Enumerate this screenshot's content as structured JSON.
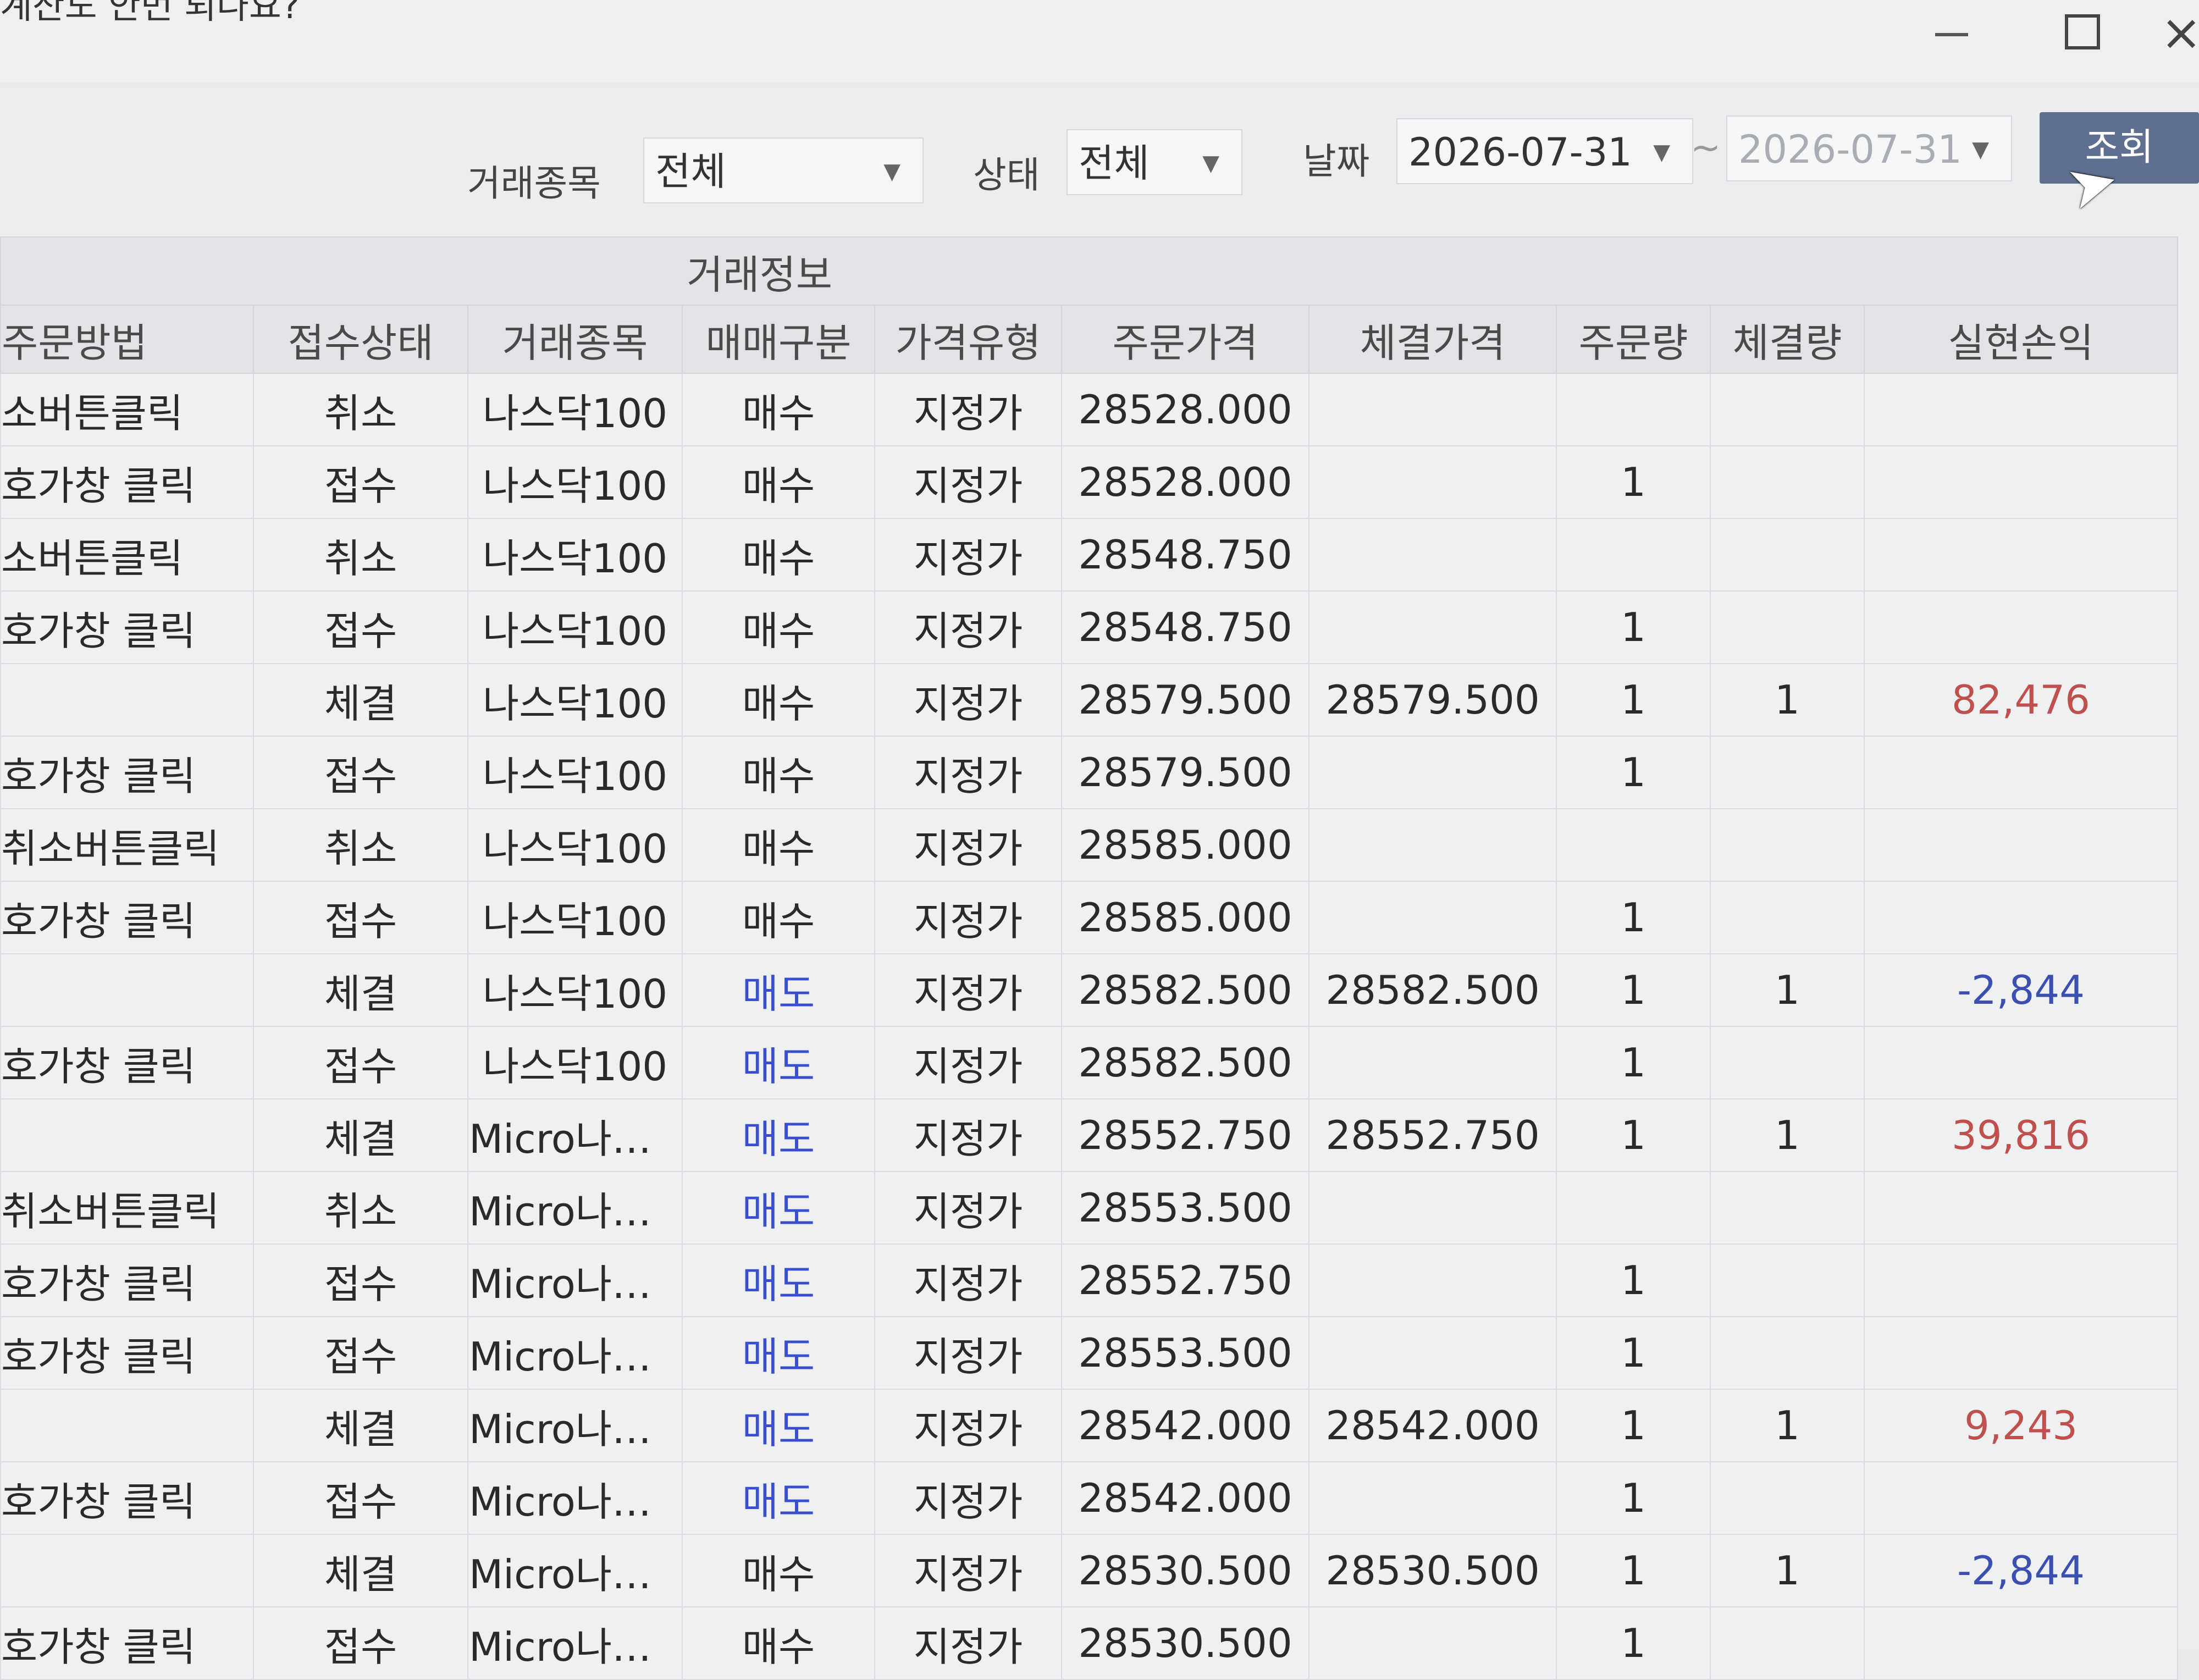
{
  "window": {
    "title": "계산도 안먼 되나요?",
    "close_symbol": "×"
  },
  "filters": {
    "item_label": "거래종목",
    "item_value": "전체",
    "status_label": "상태",
    "status_value": "전체",
    "date_label": "날짜",
    "date_from": "2026-07-31",
    "date_sep": "~",
    "date_to": "2026-07-31",
    "query_label": "조회"
  },
  "grid": {
    "group_header": "거래정보",
    "columns": [
      "주문방법",
      "접수상태",
      "거래종목",
      "매매구분",
      "가격유형",
      "주문가격",
      "체결가격",
      "주문량",
      "체결량",
      "실현손익"
    ],
    "rows": [
      {
        "method": "소버튼클릭",
        "status": "취소",
        "item": "나스닥100",
        "side": "매수",
        "ptype": "지정가",
        "oprice": "28528.000",
        "fprice": "",
        "oqty": "",
        "fqty": "",
        "pnl": ""
      },
      {
        "method": "호가창 클릭",
        "status": "접수",
        "item": "나스닥100",
        "side": "매수",
        "ptype": "지정가",
        "oprice": "28528.000",
        "fprice": "",
        "oqty": "1",
        "fqty": "",
        "pnl": ""
      },
      {
        "method": "소버튼클릭",
        "status": "취소",
        "item": "나스닥100",
        "side": "매수",
        "ptype": "지정가",
        "oprice": "28548.750",
        "fprice": "",
        "oqty": "",
        "fqty": "",
        "pnl": ""
      },
      {
        "method": "호가창 클릭",
        "status": "접수",
        "item": "나스닥100",
        "side": "매수",
        "ptype": "지정가",
        "oprice": "28548.750",
        "fprice": "",
        "oqty": "1",
        "fqty": "",
        "pnl": ""
      },
      {
        "method": "",
        "status": "체결",
        "item": "나스닥100",
        "side": "매수",
        "ptype": "지정가",
        "oprice": "28579.500",
        "fprice": "28579.500",
        "oqty": "1",
        "fqty": "1",
        "pnl": "82,476"
      },
      {
        "method": "호가창 클릭",
        "status": "접수",
        "item": "나스닥100",
        "side": "매수",
        "ptype": "지정가",
        "oprice": "28579.500",
        "fprice": "",
        "oqty": "1",
        "fqty": "",
        "pnl": ""
      },
      {
        "method": "취소버튼클릭",
        "status": "취소",
        "item": "나스닥100",
        "side": "매수",
        "ptype": "지정가",
        "oprice": "28585.000",
        "fprice": "",
        "oqty": "",
        "fqty": "",
        "pnl": ""
      },
      {
        "method": "호가창 클릭",
        "status": "접수",
        "item": "나스닥100",
        "side": "매수",
        "ptype": "지정가",
        "oprice": "28585.000",
        "fprice": "",
        "oqty": "1",
        "fqty": "",
        "pnl": ""
      },
      {
        "method": "",
        "status": "체결",
        "item": "나스닥100",
        "side": "매도",
        "ptype": "지정가",
        "oprice": "28582.500",
        "fprice": "28582.500",
        "oqty": "1",
        "fqty": "1",
        "pnl": "-2,844"
      },
      {
        "method": "호가창 클릭",
        "status": "접수",
        "item": "나스닥100",
        "side": "매도",
        "ptype": "지정가",
        "oprice": "28582.500",
        "fprice": "",
        "oqty": "1",
        "fqty": "",
        "pnl": ""
      },
      {
        "method": "",
        "status": "체결",
        "item": "Micro나스...",
        "side": "매도",
        "ptype": "지정가",
        "oprice": "28552.750",
        "fprice": "28552.750",
        "oqty": "1",
        "fqty": "1",
        "pnl": "39,816"
      },
      {
        "method": "취소버튼클릭",
        "status": "취소",
        "item": "Micro나스...",
        "side": "매도",
        "ptype": "지정가",
        "oprice": "28553.500",
        "fprice": "",
        "oqty": "",
        "fqty": "",
        "pnl": ""
      },
      {
        "method": "호가창 클릭",
        "status": "접수",
        "item": "Micro나스...",
        "side": "매도",
        "ptype": "지정가",
        "oprice": "28552.750",
        "fprice": "",
        "oqty": "1",
        "fqty": "",
        "pnl": ""
      },
      {
        "method": "호가창 클릭",
        "status": "접수",
        "item": "Micro나스...",
        "side": "매도",
        "ptype": "지정가",
        "oprice": "28553.500",
        "fprice": "",
        "oqty": "1",
        "fqty": "",
        "pnl": ""
      },
      {
        "method": "",
        "status": "체결",
        "item": "Micro나스...",
        "side": "매도",
        "ptype": "지정가",
        "oprice": "28542.000",
        "fprice": "28542.000",
        "oqty": "1",
        "fqty": "1",
        "pnl": "9,243"
      },
      {
        "method": "호가창 클릭",
        "status": "접수",
        "item": "Micro나스...",
        "side": "매도",
        "ptype": "지정가",
        "oprice": "28542.000",
        "fprice": "",
        "oqty": "1",
        "fqty": "",
        "pnl": ""
      },
      {
        "method": "",
        "status": "체결",
        "item": "Micro나스...",
        "side": "매수",
        "ptype": "지정가",
        "oprice": "28530.500",
        "fprice": "28530.500",
        "oqty": "1",
        "fqty": "1",
        "pnl": "-2,844"
      },
      {
        "method": "호가창 클릭",
        "status": "접수",
        "item": "Micro나스...",
        "side": "매수",
        "ptype": "지정가",
        "oprice": "28530.500",
        "fprice": "",
        "oqty": "1",
        "fqty": "",
        "pnl": ""
      }
    ]
  },
  "colors": {
    "sell_text": "#3a4fd0",
    "profit_text": "#c0504d",
    "loss_text": "#3a4fb0",
    "query_button": "#5e6f8f"
  }
}
